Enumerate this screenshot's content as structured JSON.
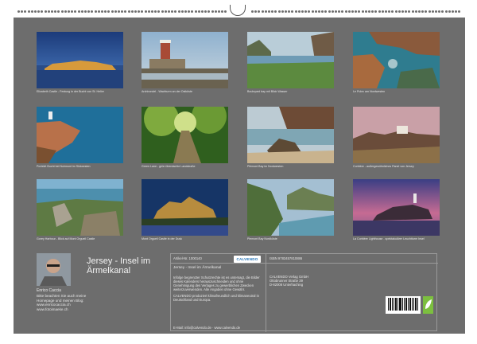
{
  "calendar": {
    "title": "Jersey - Insel im Ärmelkanal",
    "photos": [
      {
        "caption": "Elizabeth Castle - Festung in der Bucht von St. Helier"
      },
      {
        "caption": "Archirondel - Wachturm an der Ostküste"
      },
      {
        "caption": "Bouleyard bay mit Blick Wasser"
      },
      {
        "caption": "Le Pulec am Nordwesten"
      },
      {
        "caption": "Portelet Bucht bei Noirmont im Südwesten"
      },
      {
        "caption": "Green Lane - grün überdachte Landstraße"
      },
      {
        "caption": "Plémont Bay im Nordwesten"
      },
      {
        "caption": "Corbière - außergewöhnliches Panel von Jersey"
      },
      {
        "caption": "Gorey Harbour - Blick auf Mont Orgueil Castle"
      },
      {
        "caption": "Mont Orgueil Castle in der Dusk"
      },
      {
        "caption": "Plemont Bay Nordküste"
      },
      {
        "caption": "La Corbière Lighthouse - spektakulärer Leuchtturm Insel"
      }
    ],
    "author": {
      "name": "Enrico Caccia",
      "text": "Bitte beachten Sie auch meine Homepage und meinen Blog: www.enricocaccia.ch www.fotoimaeke.ch"
    },
    "info": {
      "article": "Artikel-Nr. 1000140",
      "logo": "CALVENDO",
      "isbn": "ISBN 9783457810886",
      "subtitle": "Jersey - Insel im Ärmelkanal",
      "left_text": "Infolge begrenzter Schutzrechte ist es untersagt, die Bilder dieses Kalenders herauszuschneiden und ohne Genehmigung des Verlages zu gewerblichen Zwecken weiterzuverwenden. Alle Angaben ohne Gewähr.",
      "left_text2": "CALVENDO produziert klimafreundlich und klimaneutral in Deutschland und Europa.",
      "address": "CALVENDO Verlag GmbH\nOttobrunner Straße 39\nD-82008 Unterhaching",
      "email": "E-Mail: info@calvendo.de · www.calvendo.de"
    },
    "colors": {
      "background": "#6d6d6d",
      "text": "#f4f4f4",
      "logo": "#1f72b8"
    }
  }
}
